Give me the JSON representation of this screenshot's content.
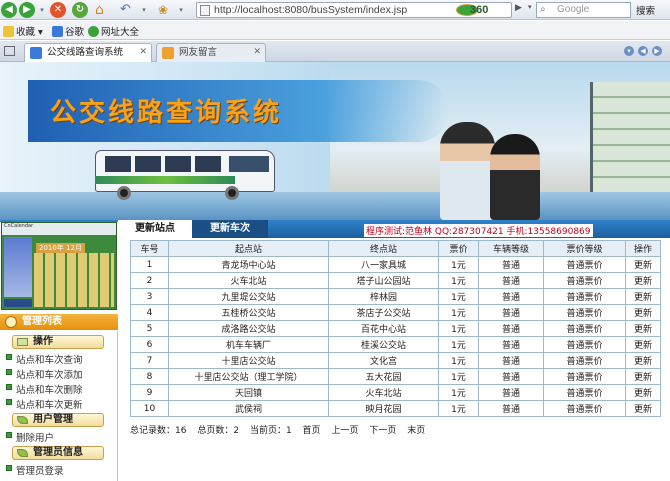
{
  "browser": {
    "url": "http://localhost:8080/busSystem/index.jsp",
    "brand": "360",
    "search_placeholder": "Google",
    "search_button": "搜索",
    "favorites": [
      "收藏",
      "谷歌",
      "网址大全"
    ],
    "tabs": [
      {
        "label": "公交线路查询系统",
        "active": true
      },
      {
        "label": "网友留言",
        "active": false
      }
    ]
  },
  "banner": {
    "title": "公交线路查询系统"
  },
  "nav": {
    "tabs": [
      "更新站点",
      "更新车次"
    ],
    "author": "程序测试:范鱼林  QQ:287307421 手机:13558690869"
  },
  "calendar": {
    "header": "CnCalendar",
    "year_month": "2010年 12月"
  },
  "sidebar": {
    "title": "管理列表",
    "sections": [
      {
        "label": "操作",
        "items": [
          "站点和车次查询",
          "站点和车次添加",
          "站点和车次删除",
          "站点和车次更新"
        ]
      },
      {
        "label": "用户管理",
        "items": [
          "删除用户"
        ]
      },
      {
        "label": "管理员信息",
        "items": [
          "管理员登录"
        ]
      }
    ]
  },
  "table": {
    "columns": [
      "车号",
      "起点站",
      "终点站",
      "票价",
      "车辆等级",
      "票价等级",
      "操作"
    ],
    "rows": [
      [
        "1",
        "青龙场中心站",
        "八一家具城",
        "1元",
        "普通",
        "普通票价",
        "更新"
      ],
      [
        "2",
        "火车北站",
        "塔子山公园站",
        "1元",
        "普通",
        "普通票价",
        "更新"
      ],
      [
        "3",
        "九里堤公交站",
        "梓林园",
        "1元",
        "普通",
        "普通票价",
        "更新"
      ],
      [
        "4",
        "五桂桥公交站",
        "茶店子公交站",
        "1元",
        "普通",
        "普通票价",
        "更新"
      ],
      [
        "5",
        "成洛路公交站",
        "百花中心站",
        "1元",
        "普通",
        "普通票价",
        "更新"
      ],
      [
        "6",
        "机车车辆厂",
        "桂溪公交站",
        "1元",
        "普通",
        "普通票价",
        "更新"
      ],
      [
        "7",
        "十里店公交站",
        "文化宫",
        "1元",
        "普通",
        "普通票价",
        "更新"
      ],
      [
        "8",
        "十里店公交站（理工学院）",
        "五大花园",
        "1元",
        "普通",
        "普通票价",
        "更新"
      ],
      [
        "9",
        "天回镇",
        "火车北站",
        "1元",
        "普通",
        "普通票价",
        "更新"
      ],
      [
        "10",
        "武侯祠",
        "映月花园",
        "1元",
        "普通",
        "普通票价",
        "更新"
      ]
    ]
  },
  "pager": {
    "total_records": "总记录数：16",
    "total_pages": "总页数：2",
    "current_page": "当前页：1",
    "first": "首页",
    "prev": "上一页",
    "next": "下一页",
    "last": "末页"
  }
}
